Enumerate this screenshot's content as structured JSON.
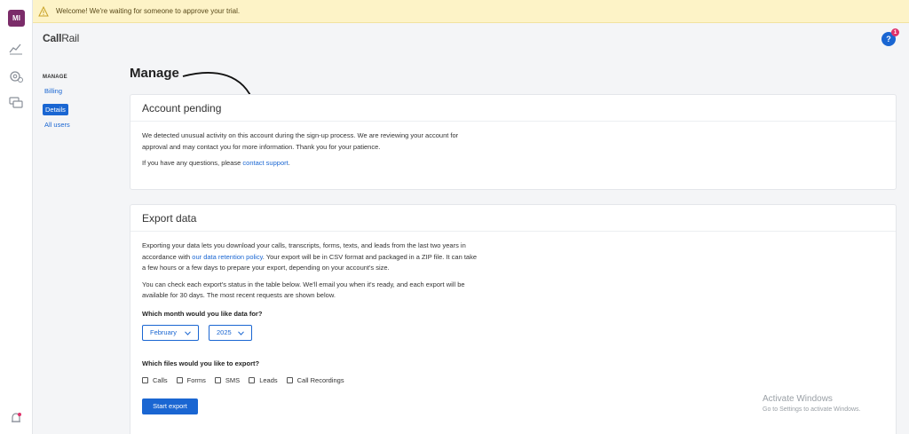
{
  "rail": {
    "avatar_initials": "MI",
    "icons": [
      "chart-icon",
      "settings-gear-icon",
      "chat-icon",
      "notification-bell-icon"
    ]
  },
  "banner": {
    "text": "Welcome! We're waiting for someone to approve your trial."
  },
  "logo": {
    "part1": "Call",
    "part2": "Rail"
  },
  "help": {
    "label": "?",
    "badge_count": "1"
  },
  "subnav": {
    "heading": "MANAGE",
    "items": [
      {
        "label": "Billing",
        "active": false
      },
      {
        "label": "Details",
        "active": true
      },
      {
        "label": "All users",
        "active": false
      }
    ]
  },
  "page": {
    "title": "Manage"
  },
  "pending": {
    "title": "Account pending",
    "body1": "We detected unusual activity on this account during the sign-up process. We are reviewing your account for approval and may contact you for more information. Thank you for your patience.",
    "body2_prefix": "If you have any questions, please ",
    "body2_link": "contact support",
    "body2_suffix": "."
  },
  "export": {
    "title": "Export data",
    "para1_prefix": "Exporting your data lets you download your calls, transcripts, forms, texts, and leads from the last two years in accordance with ",
    "para1_link": "our data retention policy",
    "para1_suffix": ". Your export will be in CSV format and packaged in a ZIP file. It can take a few hours or a few days to prepare your export, depending on your account's size.",
    "para2": "You can check each export's status in the table below. We'll email you when it's ready, and each export will be available for 30 days. The most recent requests are shown below.",
    "month_question": "Which month would you like data for?",
    "month_value": "February",
    "year_value": "2025",
    "files_question": "Which files would you like to export?",
    "files": [
      "Calls",
      "Forms",
      "SMS",
      "Leads",
      "Call Recordings"
    ],
    "button": "Start export"
  },
  "watermark": {
    "title": "Activate Windows",
    "sub": "Go to Settings to activate Windows."
  }
}
